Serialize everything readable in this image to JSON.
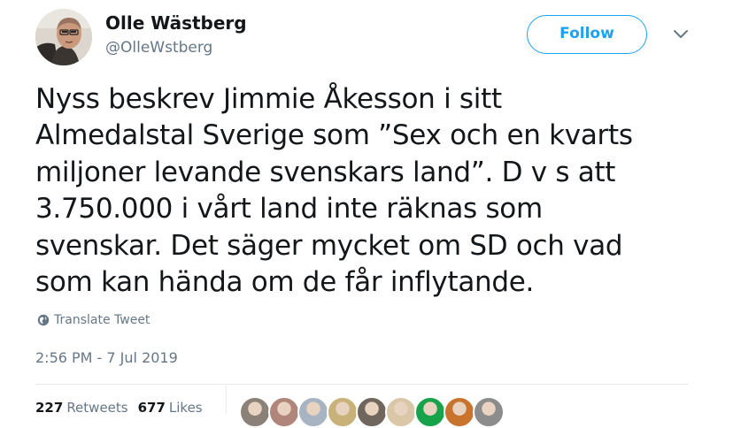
{
  "author": {
    "display_name": "Olle Wästberg",
    "handle": "@OlleWstberg"
  },
  "actions": {
    "follow_label": "Follow"
  },
  "tweet": {
    "lines": [
      "Nyss beskrev Jimmie Åkesson i sitt",
      "Almedalstal Sverige som ”Sex och en kvarts",
      "miljoner levande svenskars land”. D v s att",
      "3.750.000 i vårt land inte räknas som",
      "svenskar. Det säger mycket om SD och vad",
      "som kan hända om de får inflytande."
    ],
    "translate_label": "Translate Tweet",
    "timestamp": "2:56 PM - 7 Jul 2019"
  },
  "stats": {
    "retweets_count": "227",
    "retweets_label": "Retweets",
    "likes_count": "677",
    "likes_label": "Likes"
  },
  "colors": {
    "accent": "#1da1f2",
    "text": "#14171a",
    "secondary": "#657786",
    "divider": "#e6ecf0"
  },
  "likers": [
    {
      "color": "#8a8178"
    },
    {
      "color": "#b0857a"
    },
    {
      "color": "#a8b4c2"
    },
    {
      "color": "#c9b27a"
    },
    {
      "color": "#6f665e"
    },
    {
      "color": "#d9c7a8"
    },
    {
      "color": "#17a34a"
    },
    {
      "color": "#c8742e"
    },
    {
      "color": "#8c8c8c"
    }
  ]
}
